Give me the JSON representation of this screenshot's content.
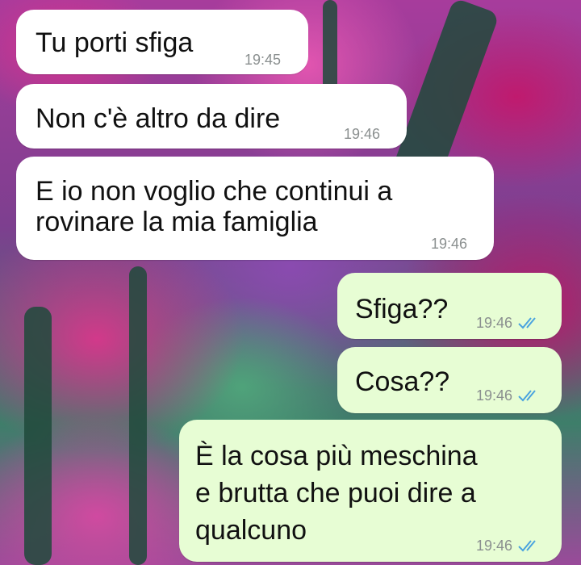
{
  "chat": {
    "wallpaper": "pink-forest-wallpaper",
    "colors": {
      "incoming_bubble": "#ffffff",
      "outgoing_bubble": "#e7fdd4",
      "timestamp": "#8a8f8f",
      "read_ticks": "#4aa3df"
    },
    "messages": [
      {
        "direction": "incoming",
        "text": "Tu porti sfiga",
        "time": "19:45"
      },
      {
        "direction": "incoming",
        "text": "Non c'è altro da dire",
        "time": "19:46"
      },
      {
        "direction": "incoming",
        "text": "E io non voglio che continui a\nrovinare la mia famiglia",
        "time": "19:46"
      },
      {
        "direction": "outgoing",
        "text": "Sfiga??",
        "time": "19:46",
        "status": "read"
      },
      {
        "direction": "outgoing",
        "text": "Cosa??",
        "time": "19:46",
        "status": "read"
      },
      {
        "direction": "outgoing",
        "text": "È la cosa più meschina\ne brutta che puoi dire a\nqualcuno",
        "time": "19:46",
        "status": "read"
      }
    ]
  }
}
